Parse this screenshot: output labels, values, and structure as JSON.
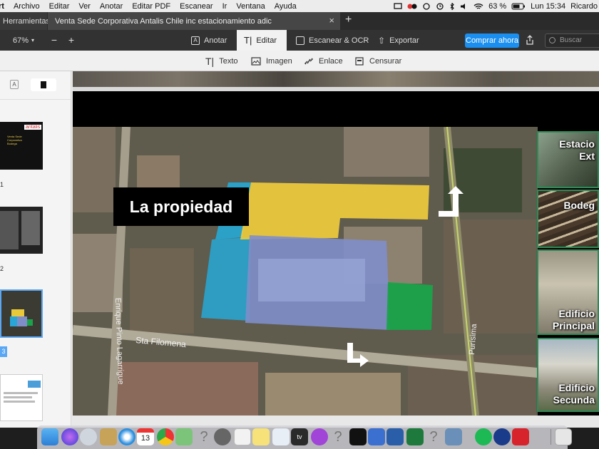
{
  "menubar": {
    "app": "rt",
    "items": [
      "Archivo",
      "Editar",
      "Ver",
      "Anotar",
      "Editar PDF",
      "Escanear",
      "Ir",
      "Ventana",
      "Ayuda"
    ],
    "battery": "63 %",
    "clock": "Lun 15:34",
    "user": "Ricardo"
  },
  "tabs": {
    "tools": "Herramientas",
    "document": "Venta Sede Corporativa Antalis Chile inc estacionamiento adic",
    "add": "+"
  },
  "toolbar": {
    "zoom": "67%",
    "zoom_out": "−",
    "zoom_in": "+",
    "modes": [
      "Anotar",
      "Editar",
      "Escanear & OCR",
      "Exportar"
    ],
    "active_mode": "Editar",
    "buy": "Comprar ahora",
    "search_placeholder": "Buscar"
  },
  "edit_tools": [
    "Texto",
    "Imagen",
    "Enlace",
    "Censurar"
  ],
  "sidebar": {
    "page_numbers": [
      "1",
      "2",
      "3"
    ],
    "thumb1_brand": "antalis",
    "thumb1_text": "Venta Sede Corporativa Bodega"
  },
  "slide": {
    "title": "La propiedad",
    "street_1": "Sta Filomena",
    "street_2": "Enrique Pinto Lagarrigue",
    "street_3": "Purísima",
    "side_labels": [
      {
        "l1": "Estacio",
        "l2": "Ext"
      },
      {
        "l1": "Bodeg",
        "l2": ""
      },
      {
        "l1": "Edificio",
        "l2": "Principal"
      },
      {
        "l1": "Edificio",
        "l2": "Secunda"
      }
    ]
  },
  "colors": {
    "yellow_zone": "#f2cd3c",
    "cyan_zone": "#26a9d6",
    "blue_zone": "#7f8ec9",
    "green_zone": "#1aa34a",
    "accent": "#1b8ff0"
  },
  "dock": {
    "calendar_day": "13",
    "tv_label": "tv"
  }
}
